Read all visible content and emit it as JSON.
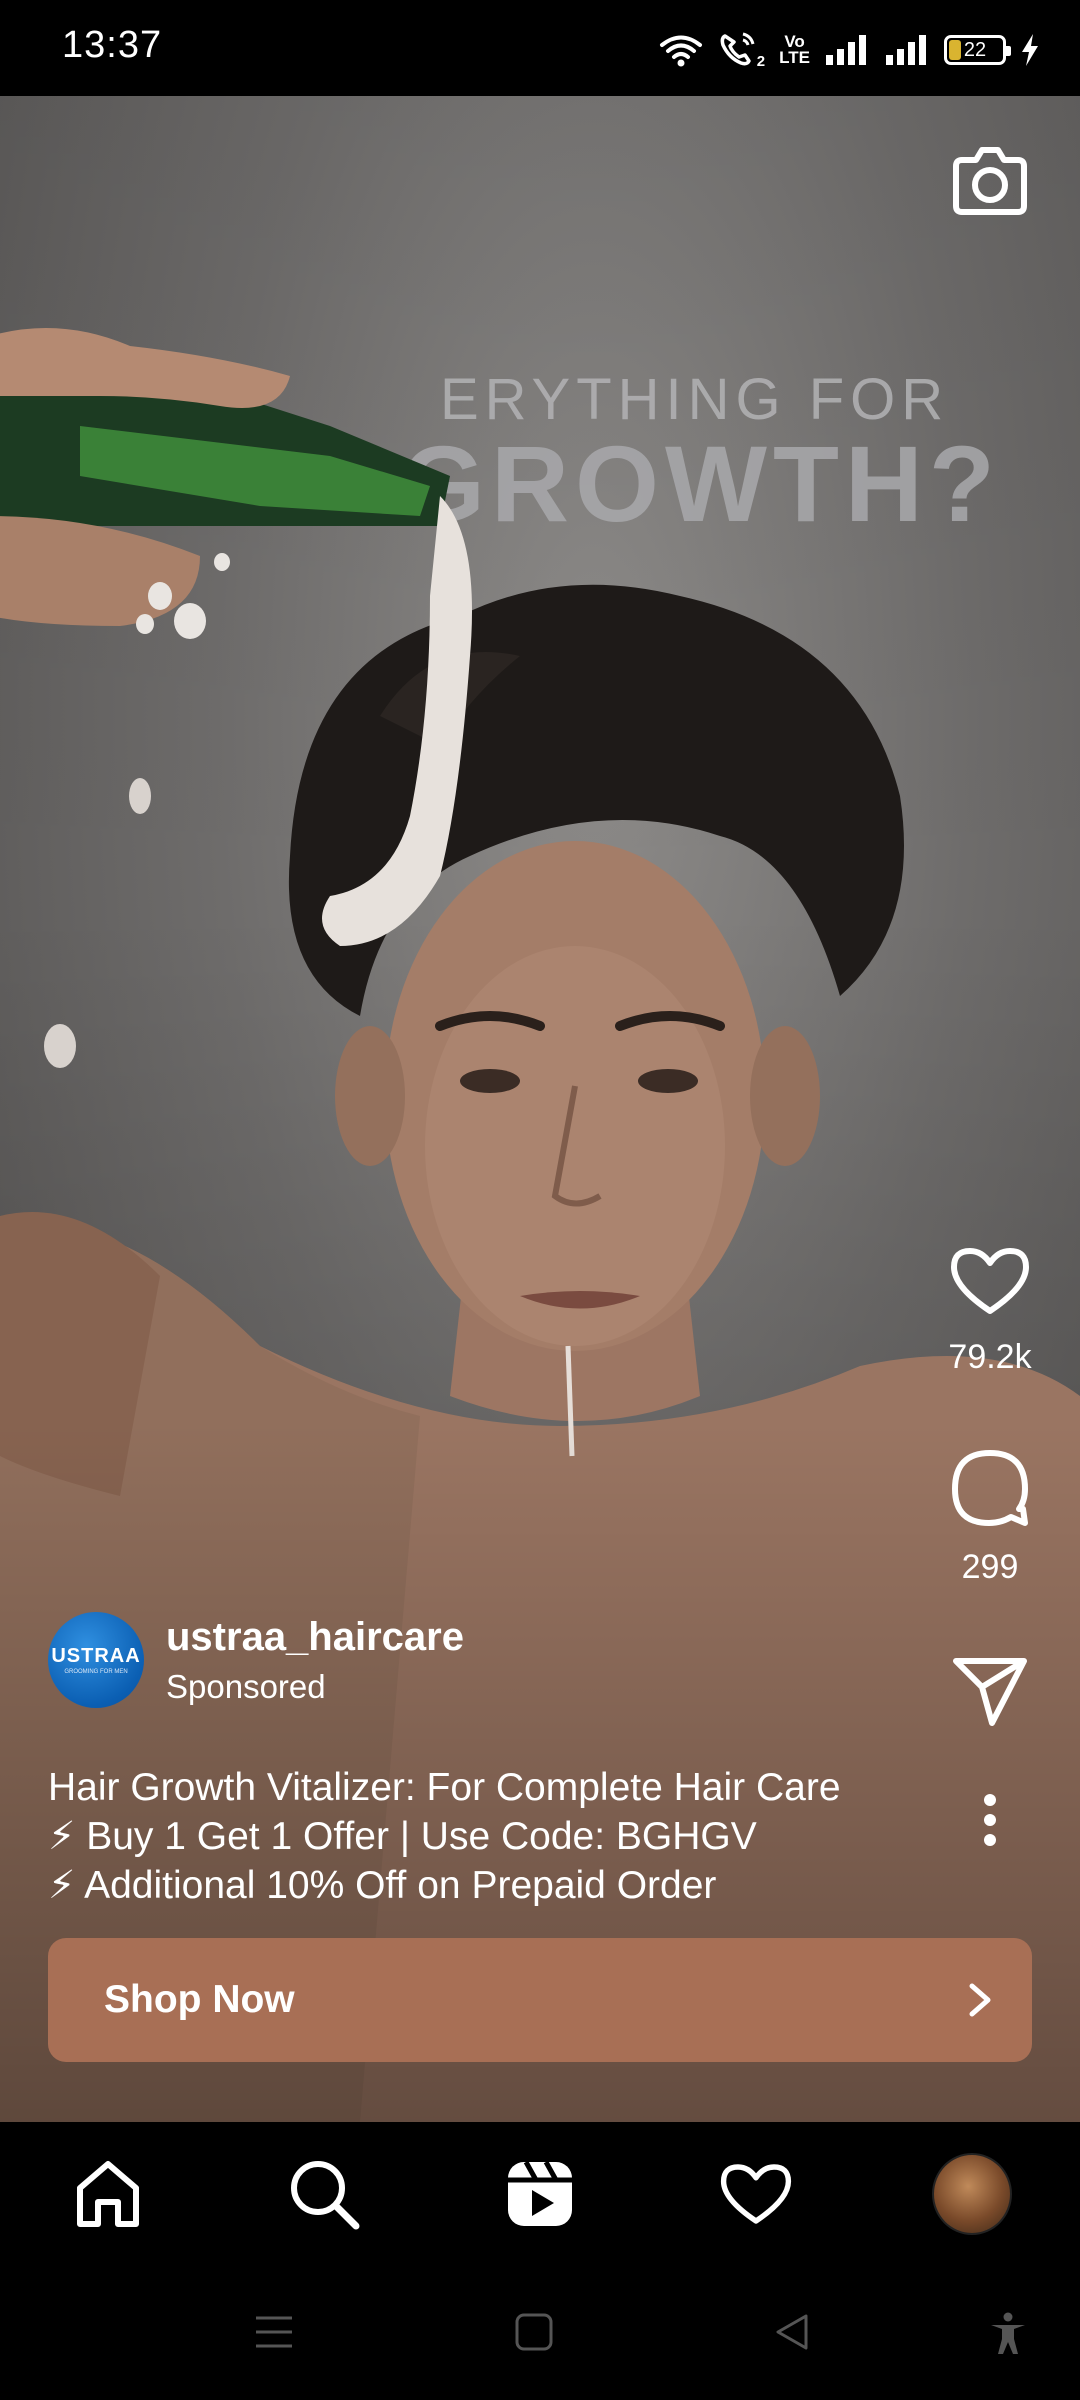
{
  "status_bar": {
    "time": "13:37",
    "network_label_top": "Vo",
    "network_label_bottom": "LTE",
    "wifi_call_badge": "2",
    "battery_level": "22"
  },
  "media": {
    "overlay_line_1": "ERYTHING FOR",
    "overlay_line_2": "IR GROWTH?"
  },
  "actions": {
    "like_count": "79.2k",
    "comment_count": "299"
  },
  "post": {
    "avatar_text": "USTRAA",
    "avatar_subtext": "GROOMING FOR MEN",
    "username": "ustraa_haircare",
    "sponsored_label": "Sponsored",
    "caption_lines": [
      "Hair Growth Vitalizer: For Complete Hair Care",
      "⚡ Buy 1 Get 1 Offer | Use Code: BGHGV",
      "⚡ Additional 10% Off on Prepaid Order"
    ],
    "cta_label": "Shop Now"
  },
  "colors": {
    "cta_background": "#a86f55",
    "bar_background": "#000000"
  },
  "icons": {
    "camera": "camera-icon",
    "like": "heart-outline-icon",
    "comment": "comment-bubble-icon",
    "share": "paper-plane-icon",
    "more": "vertical-dots-icon",
    "home": "home-icon",
    "search": "search-icon",
    "reels": "reels-icon",
    "activity": "heart-outline-icon",
    "profile": "profile-avatar"
  }
}
